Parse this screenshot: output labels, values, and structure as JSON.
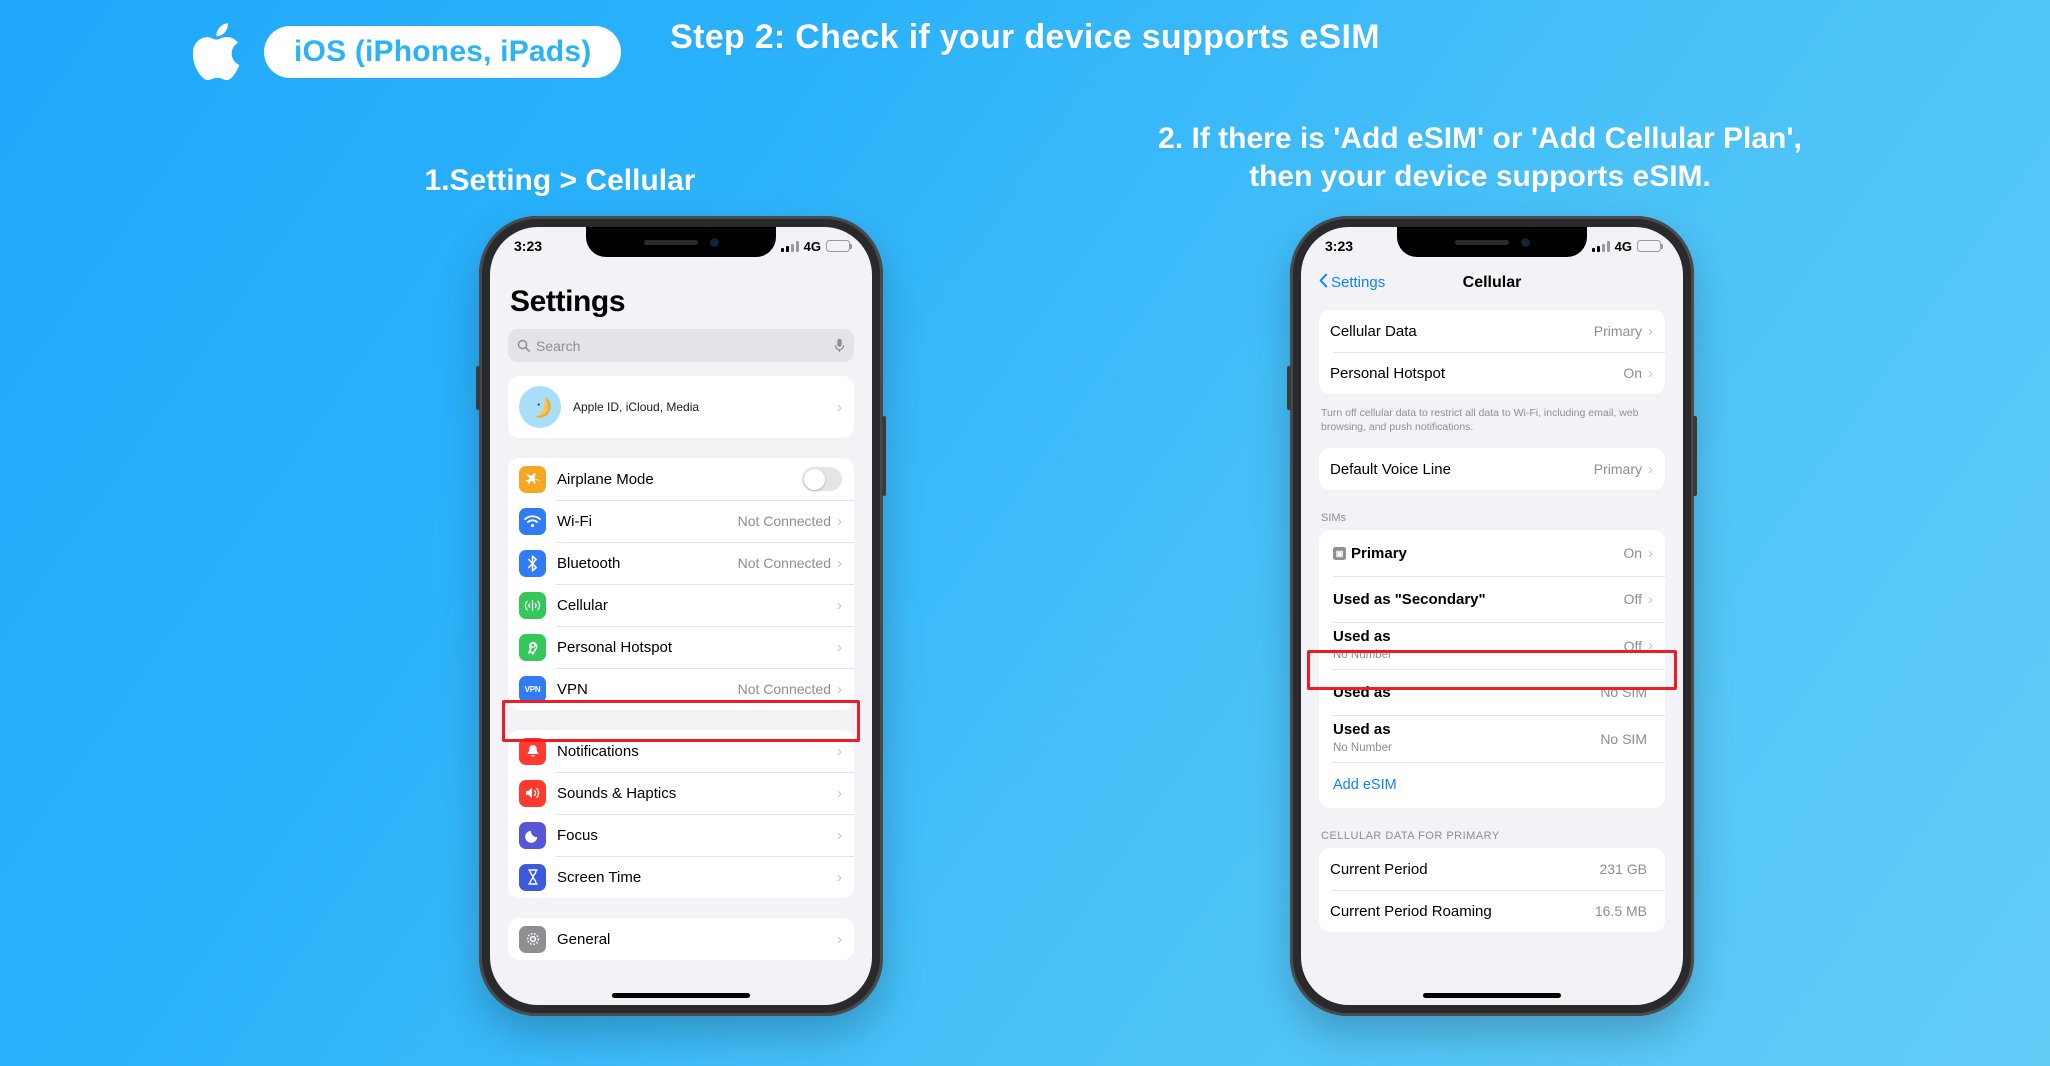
{
  "header": {
    "apple_logo": "apple-logo",
    "platform_badge": "iOS (iPhones, iPads)",
    "step_title": "Step 2: Check if your device supports eSIM"
  },
  "captions": {
    "left": "1.Setting > Cellular",
    "right_line1": "2. If there is 'Add eSIM' or 'Add Cellular Plan',",
    "right_line2": "then your device supports eSIM."
  },
  "colors": {
    "background_from": "#1FA8FA",
    "background_to": "#62CCF7",
    "badge_text": "#2BB4F5",
    "highlight": "#ee1c25",
    "ios_link": "#0a84ff"
  },
  "phone_left": {
    "statusbar": {
      "time": "3:23",
      "network": "4G",
      "battery_level": "24"
    },
    "title": "Settings",
    "search": {
      "placeholder": "Search",
      "icon": "search-icon",
      "mic_icon": "microphone-icon"
    },
    "profile": {
      "subtitle": "Apple ID, iCloud, Media",
      "avatar": "crescent-moon-avatar"
    },
    "groups": [
      {
        "rows": [
          {
            "label": "Airplane Mode",
            "icon": "airplane-icon",
            "icon_color": "#f5a623",
            "control": "toggle",
            "toggle_on": false
          },
          {
            "label": "Wi-Fi",
            "icon": "wifi-icon",
            "icon_color": "#2f7cf6",
            "value": "Not Connected",
            "chevron": true
          },
          {
            "label": "Bluetooth",
            "icon": "bluetooth-icon",
            "icon_color": "#2f7cf6",
            "value": "Not Connected",
            "chevron": true
          },
          {
            "label": "Cellular",
            "icon": "cellular-icon",
            "icon_color": "#34c759",
            "value": "",
            "chevron": true,
            "highlighted": true
          },
          {
            "label": "Personal Hotspot",
            "icon": "hotspot-icon",
            "icon_color": "#34c759",
            "value": "",
            "chevron": true
          },
          {
            "label": "VPN",
            "icon": "vpn-icon",
            "icon_color": "#2f7cf6",
            "value": "Not Connected",
            "chevron": true
          }
        ]
      },
      {
        "rows": [
          {
            "label": "Notifications",
            "icon": "bell-icon",
            "icon_color": "#ff3b30",
            "value": "",
            "chevron": true
          },
          {
            "label": "Sounds & Haptics",
            "icon": "speaker-icon",
            "icon_color": "#ff3b30",
            "value": "",
            "chevron": true
          },
          {
            "label": "Focus",
            "icon": "moon-icon",
            "icon_color": "#5856d6",
            "value": "",
            "chevron": true
          },
          {
            "label": "Screen Time",
            "icon": "hourglass-icon",
            "icon_color": "#3b5bdb",
            "value": "",
            "chevron": true
          }
        ]
      },
      {
        "rows": [
          {
            "label": "General",
            "icon": "gear-icon",
            "icon_color": "#8e8e93",
            "value": "",
            "chevron": true
          }
        ]
      }
    ]
  },
  "phone_right": {
    "statusbar": {
      "time": "3:23",
      "network": "4G",
      "battery_level": "24"
    },
    "nav": {
      "back_label": "Settings",
      "back_icon": "chevron-left-icon",
      "title": "Cellular"
    },
    "group_data": [
      {
        "label": "Cellular Data",
        "value": "Primary",
        "chevron": true
      },
      {
        "label": "Personal Hotspot",
        "value": "On",
        "chevron": true
      }
    ],
    "footnote": "Turn off cellular data to restrict all data to Wi-Fi, including email, web browsing, and push notifications.",
    "group_voice": [
      {
        "label": "Default Voice Line",
        "value": "Primary",
        "chevron": true
      }
    ],
    "sims_header": "SIMs",
    "sims": [
      {
        "title": "Primary",
        "badge": "sim-card-badge",
        "subtitle": "",
        "blurred_sub": true,
        "value": "On",
        "chevron": true
      },
      {
        "title": "Used as \"Secondary\"",
        "subtitle": "",
        "blurred_sub": true,
        "value": "Off",
        "chevron": true
      },
      {
        "title": "Used as",
        "subtitle": "No Number",
        "value": "Off",
        "chevron": true
      },
      {
        "title": "Used as",
        "subtitle": "",
        "blurred_sub": true,
        "value": "No SIM",
        "chevron": false
      },
      {
        "title": "Used as",
        "subtitle": "No Number",
        "value": "No SIM",
        "chevron": false
      }
    ],
    "add_esim": "Add eSIM",
    "data_header": "CELLULAR DATA FOR PRIMARY",
    "data_rows": [
      {
        "label": "Current Period",
        "value": "231 GB"
      },
      {
        "label": "Current Period Roaming",
        "value": "16.5 MB"
      }
    ]
  }
}
